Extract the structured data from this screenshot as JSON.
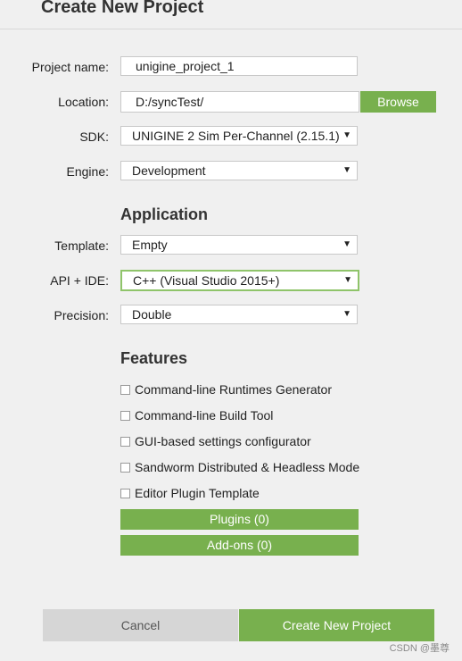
{
  "dialog": {
    "title": "Create New Project"
  },
  "form": {
    "project_name_label": "Project name:",
    "project_name_value": "unigine_project_1",
    "location_label": "Location:",
    "location_value": "D:/syncTest/",
    "browse_label": "Browse",
    "sdk_label": "SDK:",
    "sdk_value": "UNIGINE 2 Sim Per-Channel (2.15.1)",
    "engine_label": "Engine:",
    "engine_value": "Development"
  },
  "application": {
    "heading": "Application",
    "template_label": "Template:",
    "template_value": "Empty",
    "api_label": "API + IDE:",
    "api_value": "C++ (Visual Studio 2015+)",
    "precision_label": "Precision:",
    "precision_value": "Double"
  },
  "features": {
    "heading": "Features",
    "items": [
      {
        "label": "Command-line Runtimes Generator",
        "checked": false
      },
      {
        "label": "Command-line Build Tool",
        "checked": false
      },
      {
        "label": "GUI-based settings configurator",
        "checked": false
      },
      {
        "label": "Sandworm Distributed & Headless Mode",
        "checked": false
      },
      {
        "label": "Editor Plugin Template",
        "checked": false
      }
    ],
    "plugins_label": "Plugins (0)",
    "addons_label": "Add-ons (0)"
  },
  "footer": {
    "cancel_label": "Cancel",
    "create_label": "Create New Project"
  },
  "watermark": "CSDN @墨尊",
  "colors": {
    "accent": "#78b04e",
    "focus_border": "#8fc46a",
    "cancel_bg": "#d6d6d6"
  },
  "icons": {
    "dropdown": "triangle-down"
  }
}
